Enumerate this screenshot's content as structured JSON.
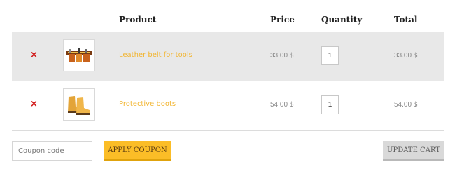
{
  "table": {
    "headers": {
      "product": "Product",
      "price": "Price",
      "quantity": "Quantity",
      "total": "Total"
    },
    "rows": [
      {
        "remove_icon": "close-icon",
        "remove_symbol": "×",
        "thumbnail_icon": "tool-belt-icon",
        "name": "Leather belt for tools",
        "price": "33.00 $",
        "quantity": "1",
        "total": "33.00 $"
      },
      {
        "remove_icon": "close-icon",
        "remove_symbol": "×",
        "thumbnail_icon": "work-boots-icon",
        "name": "Protective boots",
        "price": "54.00 $",
        "quantity": "1",
        "total": "54.00 $"
      }
    ]
  },
  "actions": {
    "coupon_placeholder": "Coupon code",
    "apply_coupon_label": "Apply coupon",
    "update_cart_label": "Update cart"
  },
  "colors": {
    "accent_link": "#f2b531",
    "remove_red": "#d11a1a",
    "apply_button_bg": "#fbbd27",
    "update_button_bg": "#d9d9d9",
    "row_stripe": "#e8e8e8"
  }
}
